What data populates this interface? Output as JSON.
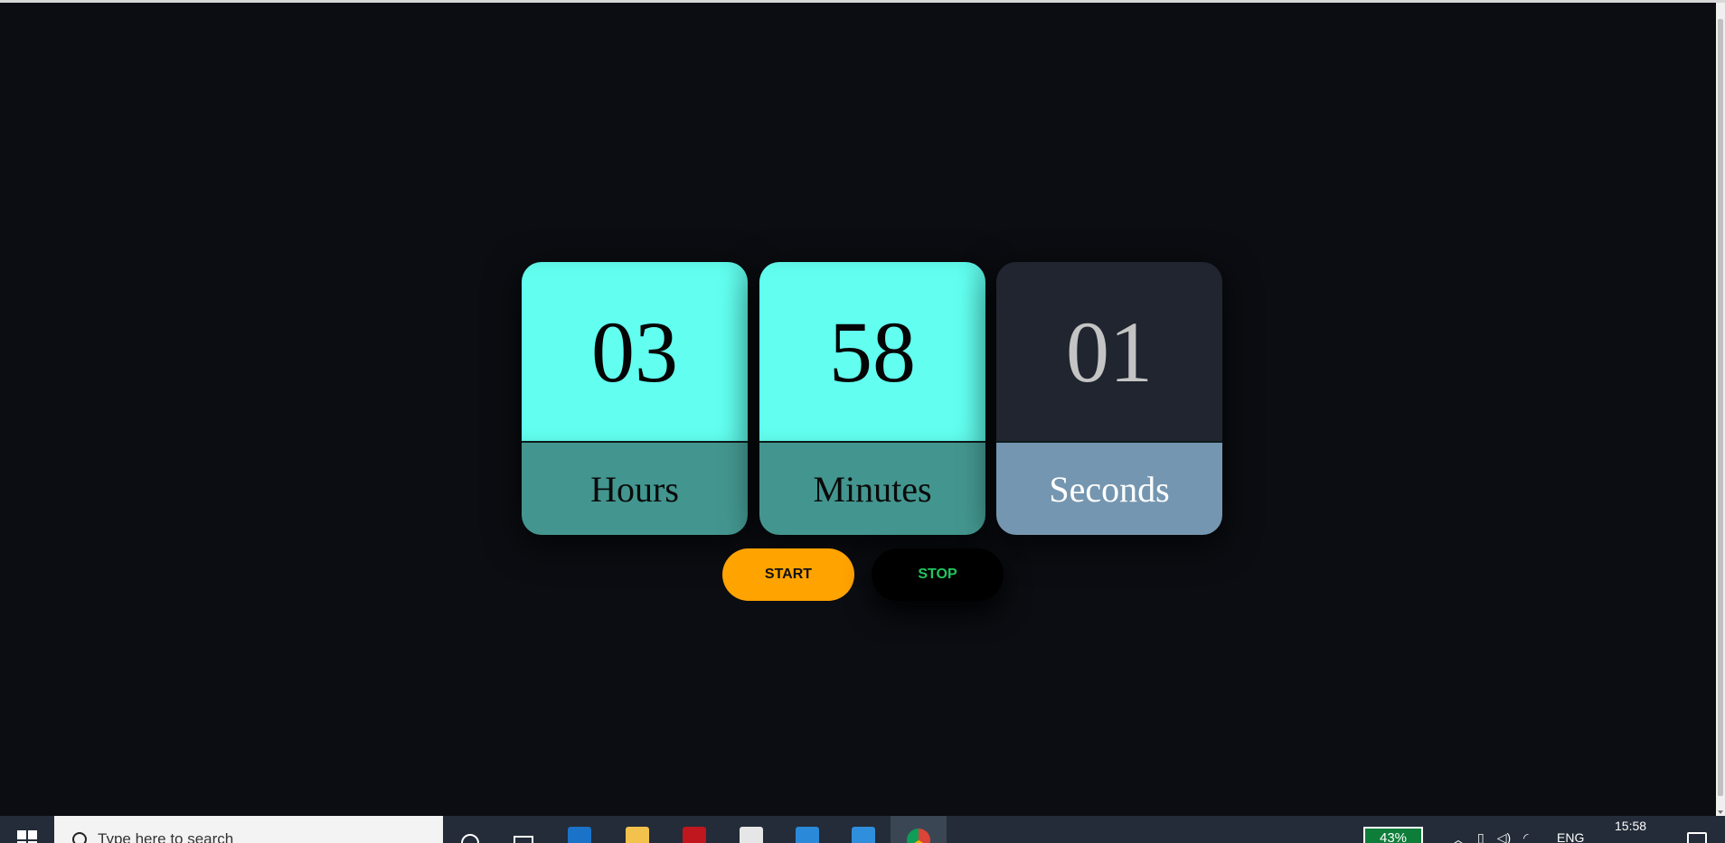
{
  "timer": {
    "hours": {
      "value": "03",
      "label": "Hours"
    },
    "minutes": {
      "value": "58",
      "label": "Minutes"
    },
    "seconds": {
      "value": "01",
      "label": "Seconds"
    }
  },
  "controls": {
    "start_label": "START",
    "stop_label": "STOP"
  },
  "colors": {
    "background": "#0b0d12",
    "teal_top": "#62fff0",
    "teal_bottom": "#43968f",
    "dark_top": "#20252f",
    "slate_bottom": "#7596b0",
    "start_button": "#ffa300",
    "stop_text": "#22c55e"
  },
  "taskbar": {
    "search_placeholder": "Type here to search",
    "battery": "43%",
    "language": "ENG",
    "clock": "15:58",
    "pinned_icons": [
      "mail-icon",
      "file-explorer-icon",
      "mcafee-icon",
      "store-icon",
      "files-icon",
      "vscode-icon",
      "chrome-icon"
    ]
  }
}
